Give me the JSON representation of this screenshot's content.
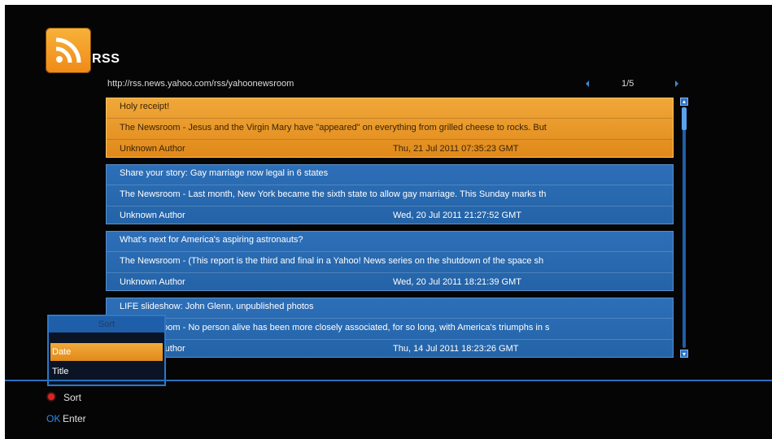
{
  "app": {
    "title": "RSS",
    "icon": "rss-feed-icon"
  },
  "feed": {
    "url": "http://rss.news.yahoo.com/rss/yahoonewsroom",
    "page": "1/5"
  },
  "articles": [
    {
      "title": "Holy receipt!",
      "summary": "The Newsroom - Jesus and the Virgin Mary have \"appeared\" on everything from grilled cheese to rocks. But",
      "author": "Unknown Author",
      "date": "Thu, 21 Jul 2011 07:35:23 GMT",
      "selected": true
    },
    {
      "title": "Share your story: Gay marriage now legal in 6 states",
      "summary": "The Newsroom - Last month, New York became the sixth state to allow gay marriage. This Sunday marks th",
      "author": "Unknown Author",
      "date": "Wed, 20 Jul 2011 21:27:52 GMT",
      "selected": false
    },
    {
      "title": "What's next for America's aspiring astronauts?",
      "summary": "The Newsroom - (This report is the third and final in a Yahoo! News series on the shutdown of the space sh",
      "author": "Unknown Author",
      "date": "Wed, 20 Jul 2011 18:21:39 GMT",
      "selected": false
    },
    {
      "title": "LIFE slideshow: John Glenn, unpublished photos",
      "summary": "The Newsroom - No person alive has been more closely associated, for so long, with America's triumphs in s",
      "author": "Unknown Author",
      "date": "Thu, 14 Jul 2011 18:23:26 GMT",
      "selected": false
    }
  ],
  "sort_popup": {
    "title": "Sort",
    "options": [
      {
        "label": "Date",
        "selected": true
      },
      {
        "label": "Title",
        "selected": false
      }
    ]
  },
  "hints": {
    "red_key_label": "Sort",
    "ok_key": "OK",
    "ok_label": "Enter"
  },
  "colors": {
    "item_blue": "#2463a7",
    "item_selected": "#e0891a",
    "accent": "#2a6fc0",
    "background": "#050506"
  }
}
